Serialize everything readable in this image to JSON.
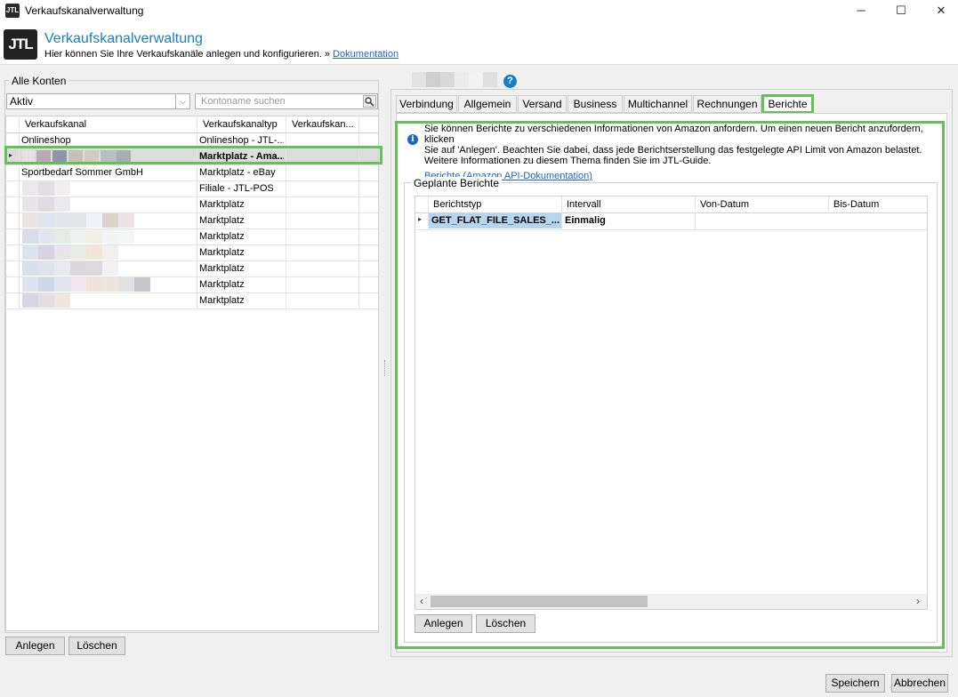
{
  "window": {
    "title": "Verkaufskanalverwaltung",
    "icon_text": "JTL",
    "controls": {
      "minimize": "─",
      "maximize": "☐",
      "close": "✕"
    }
  },
  "header": {
    "title": "Verkaufskanalverwaltung",
    "subtitle": "Hier können Sie Ihre Verkaufskanäle anlegen und konfigurieren. »",
    "doc_link": "Dokumentation",
    "logo_text": "JTL"
  },
  "accounts": {
    "group_label": "Alle Konten",
    "filter_value": "Aktiv",
    "search_placeholder": "Kontoname suchen",
    "columns": [
      "Verkaufskanal",
      "Verkaufskanaltyp",
      "Verkaufskan..."
    ],
    "rows": [
      {
        "name": "Onlineshop",
        "type": "Onlineshop - JTL-...",
        "selected": false
      },
      {
        "name": "",
        "type": "Marktplatz - Ama...",
        "selected": true
      },
      {
        "name": "Sportbedarf Sommer GmbH",
        "type": "Marktplatz - eBay",
        "selected": false
      },
      {
        "name": "",
        "type": "Filiale - JTL-POS",
        "selected": false
      },
      {
        "name": "",
        "type": "Marktplatz",
        "selected": false
      },
      {
        "name": "",
        "type": "Marktplatz",
        "selected": false
      },
      {
        "name": "",
        "type": "Marktplatz",
        "selected": false
      },
      {
        "name": "",
        "type": "Marktplatz",
        "selected": false
      },
      {
        "name": "",
        "type": "Marktplatz",
        "selected": false
      },
      {
        "name": "",
        "type": "Marktplatz",
        "selected": false
      },
      {
        "name": "",
        "type": "Marktplatz",
        "selected": false
      }
    ],
    "add_button": "Anlegen",
    "delete_button": "Löschen"
  },
  "detail": {
    "help_icon": "?",
    "tabs": [
      "Verbindung",
      "Allgemein",
      "Versand",
      "Business",
      "Multichannel",
      "Rechnungen",
      "Berichte"
    ],
    "active_tab": "Berichte",
    "info_line1": "Sie können Berichte zu verschiedenen Informationen von Amazon anfordern. Um einen neuen Bericht anzufordern, klicken",
    "info_line2": "Sie auf 'Anlegen'. Beachten Sie dabei, dass jede Berichtserstellung das festgelegte API Limit von Amazon belastet.",
    "info_line3": "Weitere Informationen zu diesem Thema finden Sie im JTL-Guide.",
    "info_link": "Berichte (Amazon API-Dokumentation)",
    "reports_group": "Geplante Berichte",
    "report_columns": [
      "Berichtstyp",
      "Intervall",
      "Von-Datum",
      "Bis-Datum"
    ],
    "report_rows": [
      {
        "type": "GET_FLAT_FILE_SALES_...",
        "interval": "Einmalig",
        "from": "",
        "to": ""
      }
    ],
    "add_button": "Anlegen",
    "delete_button": "Löschen"
  },
  "footer": {
    "save_button": "Speichern",
    "cancel_button": "Abbrechen"
  },
  "colors": {
    "accent_title": "#1c7dc2",
    "highlight_green": "#63c158",
    "selection_blue": "#b5d7ee",
    "link": "#1c64c6"
  }
}
